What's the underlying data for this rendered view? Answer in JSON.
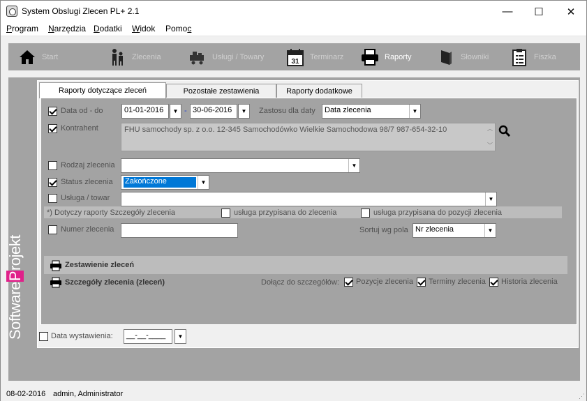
{
  "window": {
    "title": "System Obslugi Zlecen PL+ 2.1",
    "minimize": "—",
    "maximize": "☐",
    "close": "✕"
  },
  "menu": [
    {
      "u": "P",
      "rest": "rogram"
    },
    {
      "u": "N",
      "rest": "arzędzia"
    },
    {
      "u": "D",
      "rest": "odatki"
    },
    {
      "u": "W",
      "rest": "idok"
    },
    {
      "pre": "Pomo",
      "u": "c",
      "rest": ""
    }
  ],
  "toolbar": {
    "start": "Start",
    "zlecenia": "Zlecenia",
    "uslugi": "Usługi / Towary",
    "terminarz": "Terminarz",
    "terminarz_day": "31",
    "raporty": "Raporty",
    "slowniki": "Słowniki",
    "fiszka": "Fiszka"
  },
  "brand": {
    "software": "Software",
    "p": "P",
    "rojekt": "rojekt"
  },
  "tabs": {
    "t1": "Raporty dotyczące zleceń",
    "t2": "Pozostałe zestawienia",
    "t3": "Raporty dodatkowe"
  },
  "form": {
    "data_od_do": "Data od - do",
    "date_from": "01-01-2016",
    "dash": "-",
    "date_to": "30-06-2016",
    "zastosu": "Zastosu dla daty",
    "zastosu_value": "Data zlecenia",
    "kontrahent": "Kontrahent",
    "kontrahent_value": "FHU samochody sp. z o.o. 12-345 Samochodówko Wielkie Samochodowa 98/7 987-654-32-10",
    "rodzaj": "Rodzaj zlecenia",
    "rodzaj_value": "",
    "status": "Status zlecenia",
    "status_value": "Zakończone",
    "usluga": "Usługa / towar",
    "usluga_value": "",
    "note": "*) Dotyczy raporty Szczegóły zlecenia",
    "usluga_przypisana": "usługa przypisana do zlecenia",
    "usluga_pozycji": "usługa przypisana do pozycji zlecenia",
    "numer": "Numer zlecenia",
    "numer_value": "",
    "sortuj": "Sortuj wg pola",
    "sortuj_value": "Nr zlecenia"
  },
  "reports": {
    "zestawienie": "Zestawienie zleceń",
    "szczegoly": "Szczegóły zlecenia (zleceń)",
    "dolacz": "Dołącz do szczegółów:",
    "pozycje": "Pozycje zlecenia",
    "terminy": "Terminy zlecenia",
    "historia": "Historia zlecenia"
  },
  "bottom": {
    "data_wystawienia": "Data wystawienia:",
    "date_value": "__-__-____"
  },
  "status": {
    "date": "08-02-2016",
    "user": "admin, Administrator"
  }
}
